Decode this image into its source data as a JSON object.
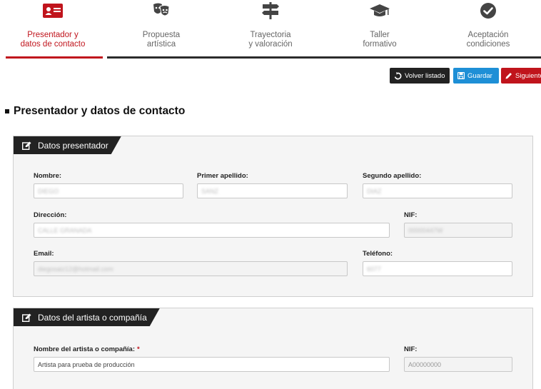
{
  "steps": [
    {
      "line1": "Presentador y",
      "line2": "datos de contacto",
      "icon": "id-card-icon",
      "active": true
    },
    {
      "line1": "Propuesta",
      "line2": "artística",
      "icon": "theater-masks-icon",
      "active": false
    },
    {
      "line1": "Trayectoria",
      "line2": "y valoración",
      "icon": "signpost-icon",
      "active": false
    },
    {
      "line1": "Taller",
      "line2": "formativo",
      "icon": "graduation-cap-icon",
      "active": false
    },
    {
      "line1": "Aceptación",
      "line2": "condiciones",
      "icon": "check-circle-icon",
      "active": false
    }
  ],
  "toolbar": {
    "back_label": "Volver listado",
    "save_label": "Guardar",
    "next_label": "Siguiente"
  },
  "page_title": "Presentador y datos de contacto",
  "presenter": {
    "title": "Datos presentador",
    "nombre_label": "Nombre:",
    "nombre_value": "DIEGO",
    "apellido1_label": "Primer apellido:",
    "apellido1_value": "SANZ",
    "apellido2_label": "Segundo apellido:",
    "apellido2_value": "DIAZ",
    "direccion_label": "Dirección:",
    "direccion_value": "CALLE GRANADA",
    "nif_label": "NIF:",
    "nif_value": "00000447W",
    "email_label": "Email:",
    "email_value": "diegosaiz12@hotmail.com",
    "telefono_label": "Teléfono:",
    "telefono_value": "6077"
  },
  "artist": {
    "title": "Datos del artista o compañía",
    "nombre_label": "Nombre del artista o compañía:",
    "required_mark": "*",
    "nombre_value": "Artista para prueba de producción",
    "nif_label": "NIF:",
    "nif_value": "A00000000"
  },
  "colors": {
    "brand_red": "#c0141c",
    "save_blue": "#1e8fd6",
    "dark": "#222222"
  }
}
